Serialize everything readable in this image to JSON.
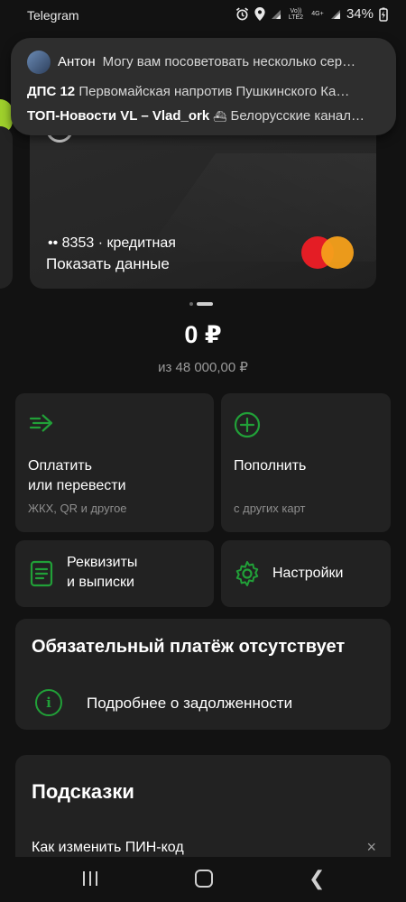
{
  "status": {
    "app": "Telegram",
    "volte": "Vo)) LTE2",
    "net": "4G+",
    "battery": "34%"
  },
  "notification": {
    "line1_sender": "Антон",
    "line1_text": "Могу вам посоветовать несколько сер…",
    "line2_title": "ДПС 12",
    "line2_text": "Первомайская напротив Пушкинского Ка…",
    "line3_title": "ТОП-Новости VL – Vlad_ork",
    "line3_text": "Белорусские канал…"
  },
  "card": {
    "number": "•• 8353 · кредитная",
    "show_data": "Показать данные",
    "brand_icon": "mastercard-logo"
  },
  "balance": {
    "amount": "0 ₽",
    "limit": "из 48 000,00 ₽"
  },
  "actions": {
    "pay": {
      "title_1": "Оплатить",
      "title_2": "или перевести",
      "sub": "ЖКХ, QR и другое",
      "icon": "transfer-arrow-icon"
    },
    "topup": {
      "title": "Пополнить",
      "sub": "с других карт",
      "icon": "plus-circle-icon"
    },
    "details": {
      "title_1": "Реквизиты",
      "title_2": "и выписки",
      "icon": "document-icon"
    },
    "settings": {
      "title": "Настройки",
      "icon": "gear-icon"
    }
  },
  "obligatory": {
    "title": "Обязательный платёж отсутствует",
    "info_glyph": "i",
    "link": "Подробнее о задолженности"
  },
  "hints": {
    "title": "Подсказки",
    "item": "Как изменить ПИН-код",
    "close_glyph": "×"
  },
  "colors": {
    "accent_green": "#21a038",
    "background": "#121212",
    "tile": "#222222"
  }
}
